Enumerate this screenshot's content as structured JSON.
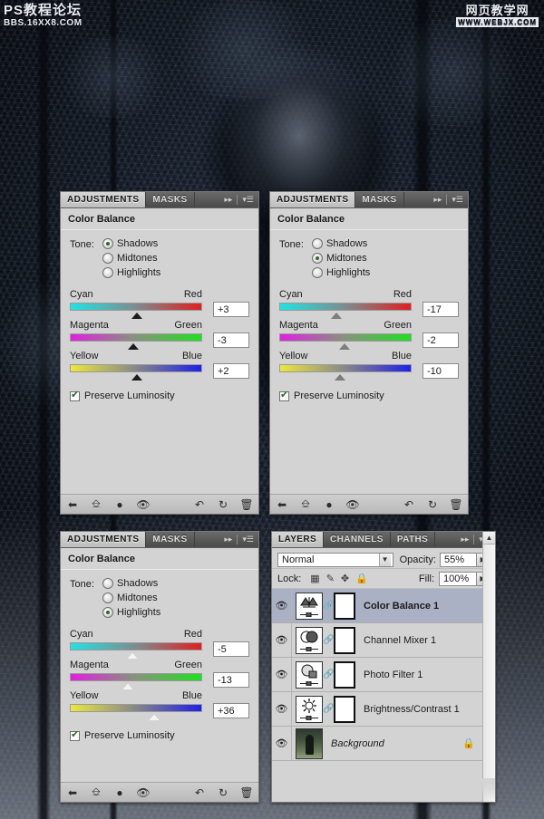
{
  "watermarks": {
    "left_line1": "PS教程论坛",
    "left_line2": "BBS.16XX8.COM",
    "right_line1": "网页教学网",
    "right_line2": "WWW.WEBJX.COM"
  },
  "panel_common": {
    "tab_adjustments": "ADJUSTMENTS",
    "tab_masks": "MASKS",
    "title": "Color Balance",
    "tone_label": "Tone:",
    "tone_options": [
      "Shadows",
      "Midtones",
      "Highlights"
    ],
    "slider_labels": [
      {
        "left": "Cyan",
        "right": "Red"
      },
      {
        "left": "Magenta",
        "right": "Green"
      },
      {
        "left": "Yellow",
        "right": "Blue"
      }
    ],
    "preserve_luminosity": "Preserve Luminosity",
    "preserve_checked": true,
    "collapse_icon": "▸▸",
    "menu_icon": "▾☰",
    "bottom_icons": [
      "back-arrow-icon",
      "clip-to-layer-icon",
      "new-adjustment-icon",
      "toggle-visibility-icon",
      "view-previous-state-icon",
      "reset-icon",
      "delete-icon"
    ]
  },
  "panels": [
    {
      "id": "shadows",
      "tone_selected": 0,
      "sliders": [
        {
          "value": "+3",
          "pos_pct": 51
        },
        {
          "value": "-3",
          "pos_pct": 48
        },
        {
          "value": "+2",
          "pos_pct": 51
        }
      ]
    },
    {
      "id": "midtones",
      "tone_selected": 1,
      "sliders": [
        {
          "value": "-17",
          "pos_pct": 43
        },
        {
          "value": "-2",
          "pos_pct": 49
        },
        {
          "value": "-10",
          "pos_pct": 46
        }
      ]
    },
    {
      "id": "highlights",
      "tone_selected": 2,
      "sliders": [
        {
          "value": "-5",
          "pos_pct": 47
        },
        {
          "value": "-13",
          "pos_pct": 44
        },
        {
          "value": "+36",
          "pos_pct": 64
        }
      ]
    }
  ],
  "layers": {
    "tabs": [
      "LAYERS",
      "CHANNELS",
      "PATHS"
    ],
    "active_tab": "LAYERS",
    "collapse_icon": "▸▸",
    "menu_icon": "▾☰",
    "blend_mode": "Normal",
    "opacity_label": "Opacity:",
    "opacity_value": "55%",
    "lock_label": "Lock:",
    "lock_icons": [
      "lock-transparency-icon",
      "lock-image-icon",
      "lock-position-icon",
      "lock-all-icon"
    ],
    "fill_label": "Fill:",
    "fill_value": "100%",
    "rows": [
      {
        "name": "Color Balance 1",
        "kind": "color-balance",
        "selected": true,
        "visible": true,
        "has_mask": true,
        "locked": false
      },
      {
        "name": "Channel Mixer 1",
        "kind": "channel-mixer",
        "selected": false,
        "visible": true,
        "has_mask": true,
        "locked": false
      },
      {
        "name": "Photo Filter 1",
        "kind": "photo-filter",
        "selected": false,
        "visible": true,
        "has_mask": true,
        "locked": false
      },
      {
        "name": "Brightness/Contrast 1",
        "kind": "brightness-contrast",
        "selected": false,
        "visible": true,
        "has_mask": true,
        "locked": false
      },
      {
        "name": "Background",
        "kind": "background",
        "selected": false,
        "visible": true,
        "has_mask": false,
        "locked": true
      }
    ],
    "scroll_up_icon": "▲"
  },
  "colors": {
    "panel_bg": "#d3d3d3",
    "tab_bar": "#5a5a5a",
    "selected_row": "#aab1c4",
    "radio_dot": "#2d6a2d",
    "check": "#2d6a2d"
  }
}
